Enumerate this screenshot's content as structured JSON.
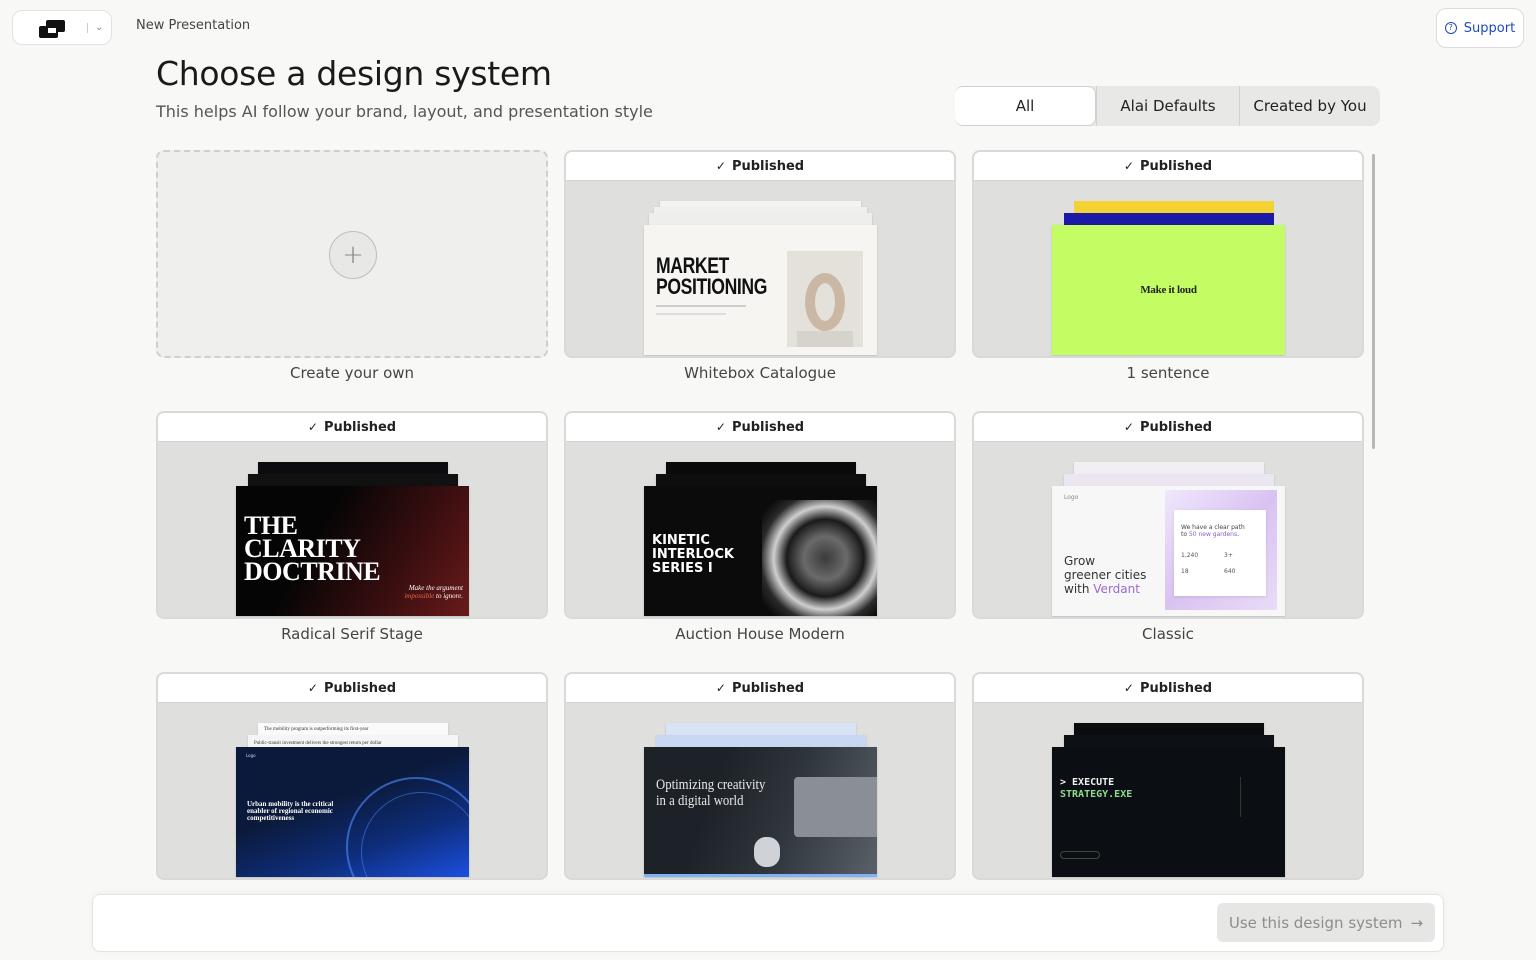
{
  "header": {
    "doc_title": "New Presentation",
    "support_label": "Support",
    "logo_icon": "alai-logo-icon",
    "chevron_icon": "chevron-down-icon"
  },
  "main": {
    "title": "Choose a design system",
    "subtitle": "This helps AI follow your brand, layout, and presentation style",
    "filters": [
      {
        "label": "All",
        "active": true
      },
      {
        "label": "Alai Defaults",
        "active": false
      },
      {
        "label": "Created by You",
        "active": false
      }
    ]
  },
  "create_card": {
    "label": "Create your own",
    "icon": "plus-icon"
  },
  "published_label": "Published",
  "cards": [
    {
      "label": "Whitebox Catalogue",
      "preview": {
        "heading1": "MARKET",
        "heading2": "POSITIONING"
      }
    },
    {
      "label": "1 sentence",
      "preview": {
        "text": "Make it loud"
      }
    },
    {
      "label": "Radical Serif Stage",
      "preview": {
        "heading1": "THE",
        "heading2": "CLARITY",
        "heading3": "DOCTRINE",
        "tagline1": "Make the argument",
        "tagline2a": "impossible",
        "tagline2b": " to ignore."
      }
    },
    {
      "label": "Auction House Modern",
      "preview": {
        "heading1": "KINETIC",
        "heading2": "INTERLOCK",
        "heading3": "SERIES I"
      }
    },
    {
      "label": "Classic",
      "preview": {
        "logo": "Logo",
        "line1": "Grow",
        "line2": "greener cities",
        "line3a": "with ",
        "line3b": "Verdant",
        "card_text1": "We have a clear path",
        "card_text2a": "to ",
        "card_text2b": "50 new gardens",
        "card_text2c": ".",
        "stat1": "1,240",
        "stat2": "3+",
        "stat3": "18",
        "stat4": "640"
      }
    },
    {
      "label": "",
      "preview": {
        "logo": "Logo",
        "text": "Urban mobility is the critical enabler of regional economic competitiveness",
        "behind1": "The mobility program is outperforming its first-year",
        "behind2": "Public-transit investment delivers the strongest return per dollar"
      }
    },
    {
      "label": "",
      "preview": {
        "line1": "Optimizing creativity",
        "line2": "in a digital world"
      }
    },
    {
      "label": "",
      "preview": {
        "line1": "> EXECUTE",
        "line2": "STRATEGY.EXE"
      }
    }
  ],
  "footer": {
    "button_label": "Use this design system",
    "button_icon": "arrow-right-icon"
  },
  "colors": {
    "accent": "#1f4bb8",
    "lime": "#c4fc63",
    "navy": "#1a1aa6",
    "yellow": "#f4d233",
    "terminal_green": "#8fdc8f"
  }
}
